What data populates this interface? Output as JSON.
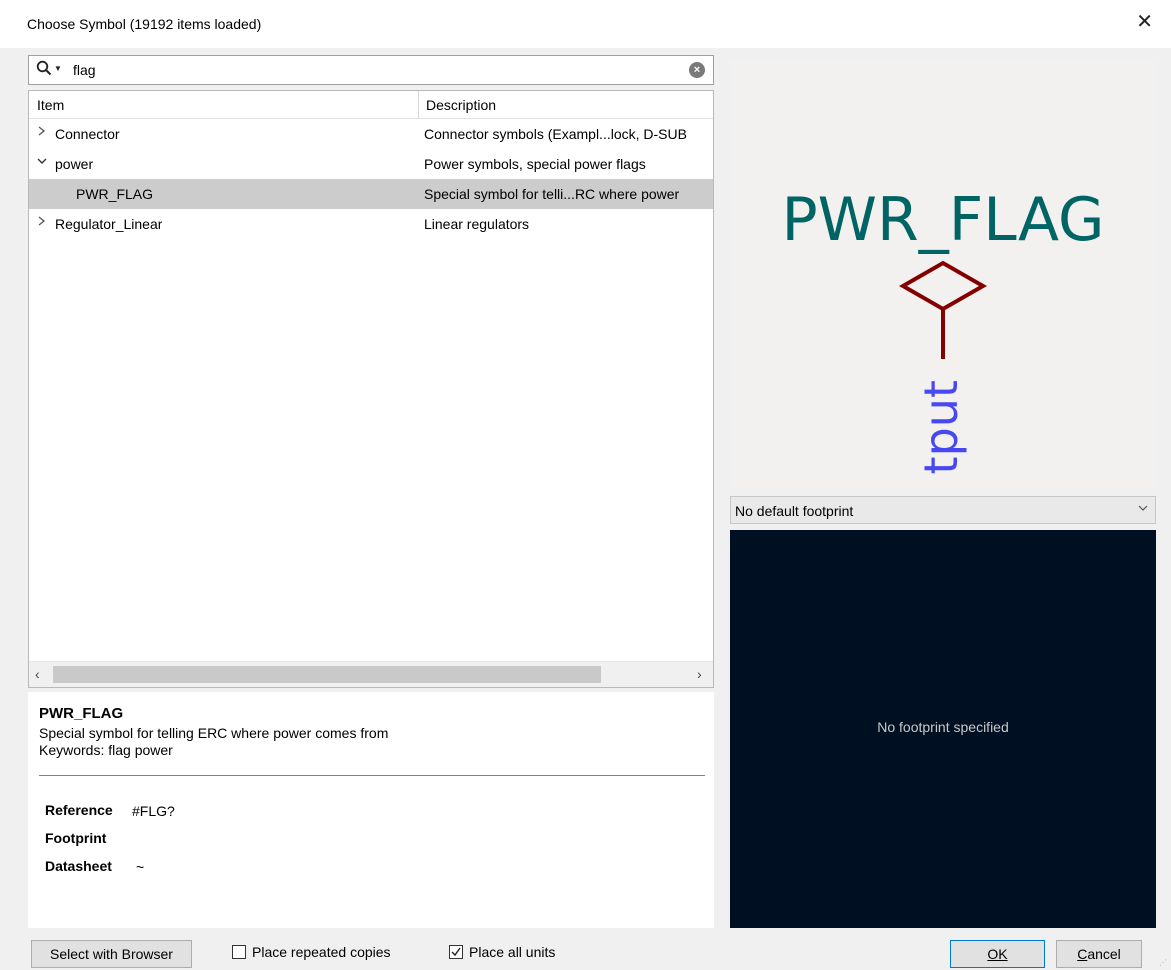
{
  "window": {
    "title": "Choose Symbol (19192 items loaded)",
    "close_glyph": "✕"
  },
  "search": {
    "value": "flag",
    "placeholder": "",
    "icon": "search-icon",
    "clear_icon": "clear-icon"
  },
  "tree": {
    "columns": [
      "Item",
      "Description"
    ],
    "rows": [
      {
        "expander": ">",
        "item": "Connector",
        "description": "Connector symbols (Exampl...lock, D-SUB"
      },
      {
        "expander": "v",
        "item": "power",
        "description": "Power symbols, special power flags"
      },
      {
        "expander": "",
        "item": "PWR_FLAG",
        "description": "Special symbol for telli...RC where power"
      },
      {
        "expander": ">",
        "item": "Regulator_Linear",
        "description": "Linear regulators"
      }
    ],
    "selected_row": 2
  },
  "details": {
    "name": "PWR_FLAG",
    "description": "Special symbol for telling ERC where power comes from",
    "keywords": "Keywords: flag power",
    "fields": [
      {
        "label": "Reference",
        "value": "#FLG?"
      },
      {
        "label": "Footprint",
        "value": ""
      },
      {
        "label": "Datasheet",
        "value": "~"
      }
    ]
  },
  "symbol_preview": {
    "value_text": "PWR_FLAG",
    "pin_text": "tput",
    "value_color": "#006464",
    "body_color": "#840000",
    "pin_color": "#4848f2",
    "background": "#f2f1ef"
  },
  "footprint": {
    "selected": "No default footprint",
    "message": "No footprint specified",
    "background": "#001023"
  },
  "buttons": {
    "select_browser": "Select with Browser",
    "ok": "OK",
    "cancel": "Cancel"
  },
  "options": {
    "place_repeated": {
      "label": "Place repeated copies",
      "checked": false
    },
    "place_all_units": {
      "label": "Place all units",
      "checked": true
    }
  },
  "colors": {
    "selection": "#cccccc",
    "accent": "#0078d7"
  }
}
